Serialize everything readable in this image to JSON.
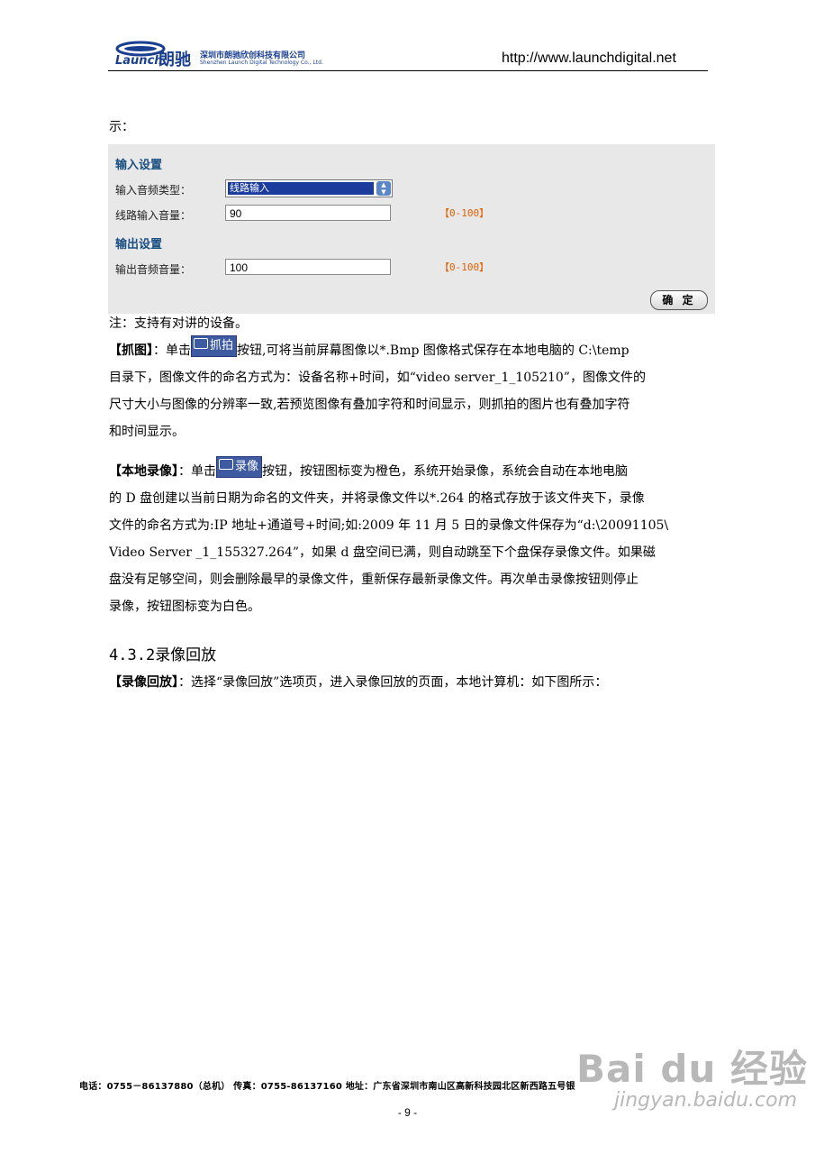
{
  "header": {
    "logo_latin": "Launch",
    "logo_cn": "朗驰",
    "company_cn": "深圳市朗驰欣创科技有限公司",
    "company_en": "Shenzhen Launch Digital Technology Co., Ltd.",
    "url": "http://www.launchdigital.net"
  },
  "prefix_text": "示：",
  "panel": {
    "input_title": "输入设置",
    "input_type_label": "输入音频类型：",
    "input_type_value": "线路输入",
    "line_volume_label": "线路输入音量：",
    "line_volume_value": "90",
    "line_volume_range": "【0-100】",
    "output_title": "输出设置",
    "output_volume_label": "输出音频音量：",
    "output_volume_value": "100",
    "output_volume_range": "【0-100】",
    "ok_label": "确 定"
  },
  "note": "注：支持有对讲的设备。",
  "snapshot": {
    "tag": "【抓图】",
    "pre": "：单击",
    "button": "抓拍",
    "l1": "按钮,可将当前屏幕图像以*.Bmp 图像格式保存在本地电脑的 C:\\temp",
    "l2": "目录下，图像文件的命名方式为：设备名称+时间，如“video server_1_105210”，图像文件的",
    "l3": "尺寸大小与图像的分辨率一致,若预览图像有叠加字符和时间显示，则抓拍的图片也有叠加字符",
    "l4": "和时间显示。"
  },
  "record": {
    "tag": "【本地录像】",
    "pre": "：单击",
    "button": "录像",
    "l1": "按钮，按钮图标变为橙色，系统开始录像，系统会自动在本地电脑",
    "l2": "的 D 盘创建以当前日期为命名的文件夹，并将录像文件以*.264 的格式存放于该文件夹下，录像",
    "l3": "文件的命名方式为:IP 地址+通道号+时间;如:2009 年 11 月 5 日的录像文件保存为“d:\\20091105\\",
    "l4": "Video Server _1_155327.264”，如果 d 盘空间已满，则自动跳至下个盘保存录像文件。如果磁",
    "l5": "盘没有足够空间，则会删除最早的录像文件，重新保存最新录像文件。再次单击录像按钮则停止",
    "l6": "录像，按钮图标变为白色。"
  },
  "section": {
    "number": "4.3.2",
    "title": "录像回放"
  },
  "playback": {
    "tag": "【录像回放】",
    "text": "：选择“录像回放”选项页，进入录像回放的页面，本地计算机：如下图所示："
  },
  "footer": {
    "text": "电话：0755－86137880（总机）   传真：0755-86137160   地址：广东省深圳市南山区高新科技园北区新西路五号银",
    "page": "- 9 -"
  },
  "watermark": {
    "logo": "Bai du 经验",
    "sub": "jingyan.baidu.com"
  }
}
